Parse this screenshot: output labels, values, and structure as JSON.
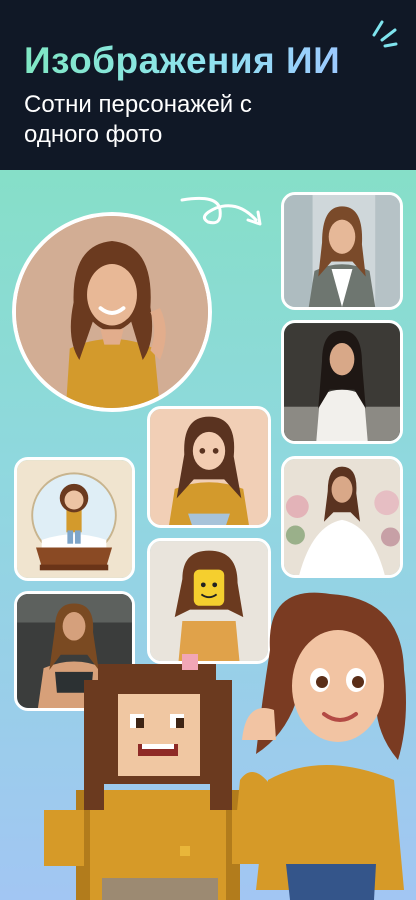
{
  "header": {
    "title": "Изображения ИИ",
    "subtitle": "Сотни персонажей с одного фото"
  },
  "colors": {
    "header_bg": "#101826",
    "title_gradient_start": "#7fe7c3",
    "title_gradient_end": "#9cc9ff",
    "canvas_top": "#86dfc8",
    "canvas_bottom": "#a2c6f3",
    "shirt_mustard": "#d39a2c"
  },
  "icons": {
    "sparkle": "sparkle-icon",
    "transform_arrow": "curly-arrow-icon"
  },
  "styles": [
    "original-portrait",
    "business-blazer",
    "elegant-white-dress",
    "anime-illustration",
    "snow-globe-figurine",
    "floral-wedding",
    "toy-brick-minifigure",
    "fitness-gym",
    "pixel-block",
    "3d-cartoon"
  ]
}
